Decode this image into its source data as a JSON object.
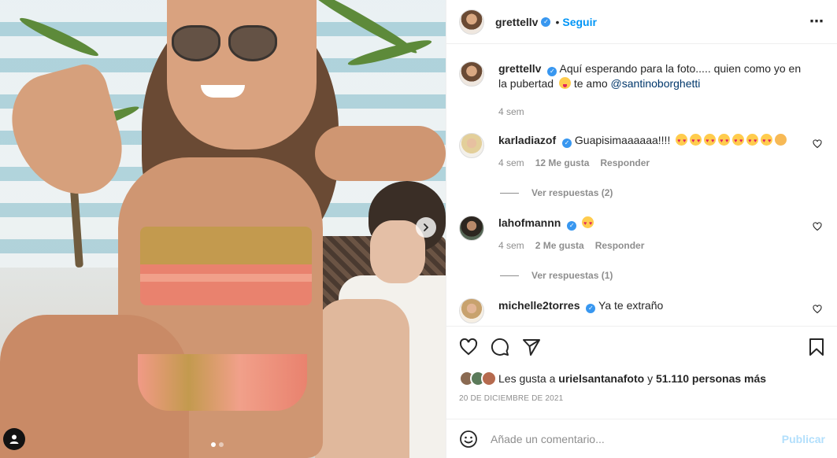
{
  "post": {
    "author": "grettellv",
    "follow_label": "Seguir",
    "more_icon": "ellipsis-icon",
    "caption": {
      "author": "grettellv",
      "text_before": "Aquí esperando para la foto..... quien como yo en la pubertad",
      "text_after": "te amo",
      "mention": "@santinoborghetti",
      "time": "4 sem"
    },
    "carousel": {
      "current": 1,
      "total": 2
    }
  },
  "comments": [
    {
      "author": "karladiazof",
      "text": "Guapisimaaaaaa!!!!",
      "time": "4 sem",
      "likes": "12 Me gusta",
      "reply_label": "Responder",
      "view_replies": "Ver respuestas (2)"
    },
    {
      "author": "lahofmannn",
      "text": "",
      "time": "4 sem",
      "likes": "2 Me gusta",
      "reply_label": "Responder",
      "view_replies": "Ver respuestas (1)"
    },
    {
      "author": "michelle2torres",
      "text": "Ya te extraño"
    }
  ],
  "likes": {
    "prefix": "Les gusta a",
    "first_user": "urielsantanafoto",
    "connector": "y",
    "others": "51.110 personas más"
  },
  "date": "20 DE DICIEMBRE DE 2021",
  "add_comment": {
    "placeholder": "Añade un comentario...",
    "publish_label": "Publicar"
  },
  "colors": {
    "accent": "#0095f6",
    "verified": "#3897f0",
    "muted": "#8e8e8e",
    "publish_disabled": "#b2dffc"
  }
}
